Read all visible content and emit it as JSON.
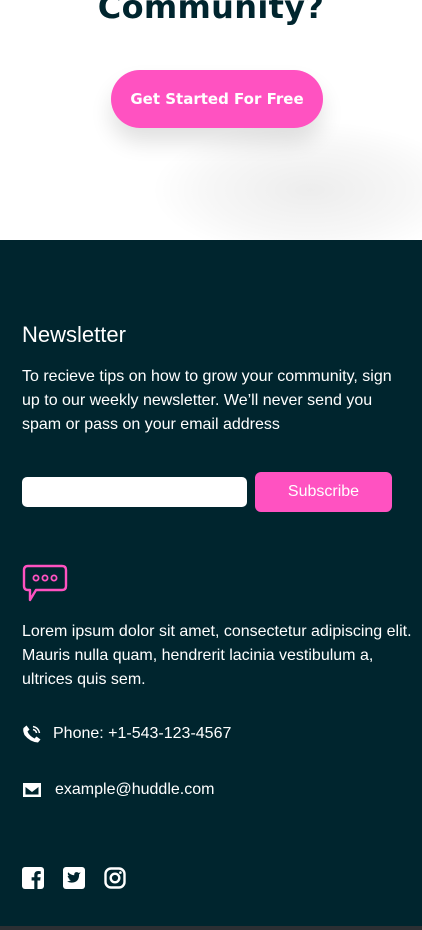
{
  "hero": {
    "title": "Community?",
    "cta_label": "Get Started For Free"
  },
  "newsletter": {
    "title": "Newsletter",
    "description": "To recieve tips on how to grow your community, sign up to our weekly newsletter. We’ll never send you spam or pass on your email address",
    "email_value": "",
    "subscribe_label": "Subscribe"
  },
  "about": {
    "text": "Lorem ipsum dolor sit amet, consectetur adipiscing elit. Mauris nulla quam, hendrerit lacinia vestibulum a, ultrices quis sem."
  },
  "contact": {
    "phone": "Phone: +1-543-123-4567",
    "email": "example@huddle.com"
  },
  "social": [
    "facebook-icon",
    "twitter-icon",
    "instagram-icon"
  ],
  "colors": {
    "accent": "#ff52c1",
    "footer_bg": "#00252e",
    "heading": "#00252e"
  }
}
